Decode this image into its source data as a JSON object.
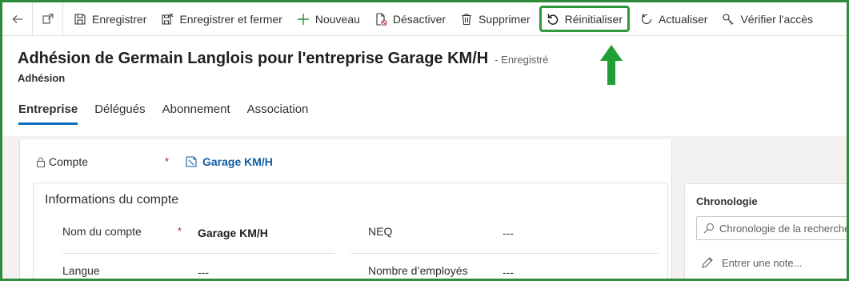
{
  "toolbar": {
    "back_icon": "back-arrow-icon",
    "popout_icon": "popout-icon",
    "commands": [
      {
        "label": "Enregistrer",
        "icon": "save-icon"
      },
      {
        "label": "Enregistrer et fermer",
        "icon": "save-close-icon"
      },
      {
        "label": "Nouveau",
        "icon": "plus-icon"
      },
      {
        "label": "Désactiver",
        "icon": "deactivate-icon"
      },
      {
        "label": "Supprimer",
        "icon": "trash-icon"
      },
      {
        "label": "Réinitialiser",
        "icon": "reset-icon"
      },
      {
        "label": "Actualiser",
        "icon": "refresh-icon"
      },
      {
        "label": "Vérifier l'accès",
        "icon": "check-access-icon"
      }
    ]
  },
  "header": {
    "title": "Adhésion de Germain Langlois pour l'entreprise Garage KM/H",
    "status": "- Enregistré",
    "entity": "Adhésion"
  },
  "tabs": [
    {
      "label": "Entreprise",
      "active": true
    },
    {
      "label": "Délégués",
      "active": false
    },
    {
      "label": "Abonnement",
      "active": false
    },
    {
      "label": "Association",
      "active": false
    }
  ],
  "form": {
    "compte_label": "Compte",
    "compte_required": "*",
    "compte_value": "Garage KM/H",
    "section_title": "Informations du compte",
    "fields": {
      "nom_label": "Nom du compte",
      "nom_required": "*",
      "nom_value": "Garage KM/H",
      "neq_label": "NEQ",
      "neq_value": "---",
      "langue_label": "Langue",
      "langue_value": "---",
      "employes_label": "Nombre d’employés",
      "employes_value": "---"
    }
  },
  "timeline": {
    "title": "Chronologie",
    "search_placeholder": "Chronologie de la recherche",
    "note_placeholder": "Entrer une note..."
  },
  "colors": {
    "accent": "#0f6cbd",
    "highlight_border": "#2e9a3c",
    "arrow": "#1e9e34",
    "frame": "#2e8b3a"
  }
}
